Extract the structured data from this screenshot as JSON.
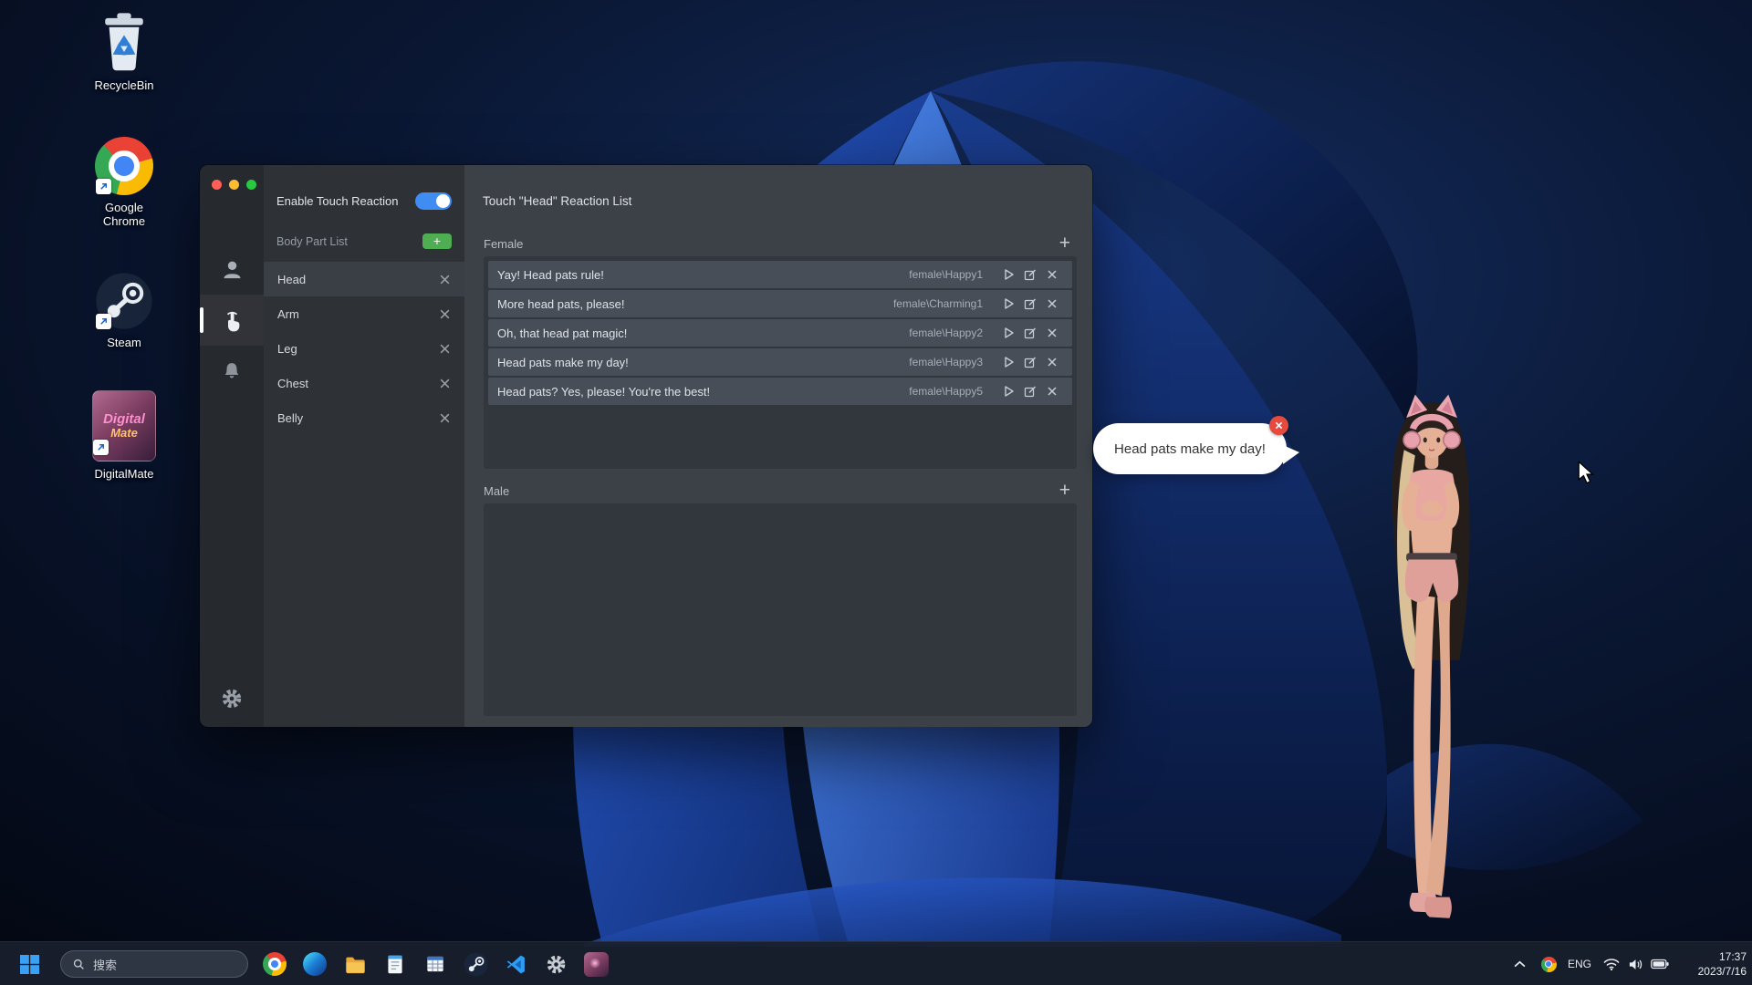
{
  "desktop": {
    "icons": [
      {
        "label": "RecycleBin"
      },
      {
        "label": "Google Chrome"
      },
      {
        "label": "Steam"
      },
      {
        "label": "DigitalMate"
      }
    ]
  },
  "window": {
    "nav_icons": [
      "profile",
      "touch",
      "notifications",
      "settings-gear"
    ],
    "touch_panel": {
      "enable_label": "Enable Touch Reaction",
      "toggle_state": "on",
      "list_label": "Body Part List",
      "add_label": "+",
      "parts": [
        {
          "label": "Head",
          "selected": true
        },
        {
          "label": "Arm",
          "selected": false
        },
        {
          "label": "Leg",
          "selected": false
        },
        {
          "label": "Chest",
          "selected": false
        },
        {
          "label": "Belly",
          "selected": false
        }
      ]
    },
    "reactions": {
      "title": "Touch \"Head\" Reaction List",
      "female": {
        "label": "Female",
        "add_label": "+",
        "items": [
          {
            "text": "Yay! Head pats rule!",
            "voice": "female\\Happy1"
          },
          {
            "text": "More head pats, please!",
            "voice": "female\\Charming1"
          },
          {
            "text": "Oh, that head pat magic!",
            "voice": "female\\Happy2"
          },
          {
            "text": "Head pats make my day!",
            "voice": "female\\Happy3"
          },
          {
            "text": "Head pats? Yes, please! You're the best!",
            "voice": "female\\Happy5"
          }
        ]
      },
      "male": {
        "label": "Male",
        "add_label": "+",
        "items": []
      }
    }
  },
  "speech_bubble": {
    "text": "Head pats make my day!"
  },
  "taskbar": {
    "search_placeholder": "搜索",
    "tray": {
      "language": "ENG",
      "time": "17:37",
      "date": "2023/7/16"
    }
  },
  "icons_map": {
    "window_controls": [
      "close",
      "minimize",
      "zoom"
    ],
    "reaction_row": [
      "play",
      "edit",
      "delete"
    ],
    "tray": [
      "chevron-up",
      "chrome",
      "wifi",
      "volume",
      "battery"
    ]
  },
  "colors": {
    "toggle_on_blue": "#3f8cf3",
    "add_button_green": "#4fae52",
    "bubble_close_red": "#e64a3c",
    "wallpaper_blue": "#2c61d9"
  }
}
